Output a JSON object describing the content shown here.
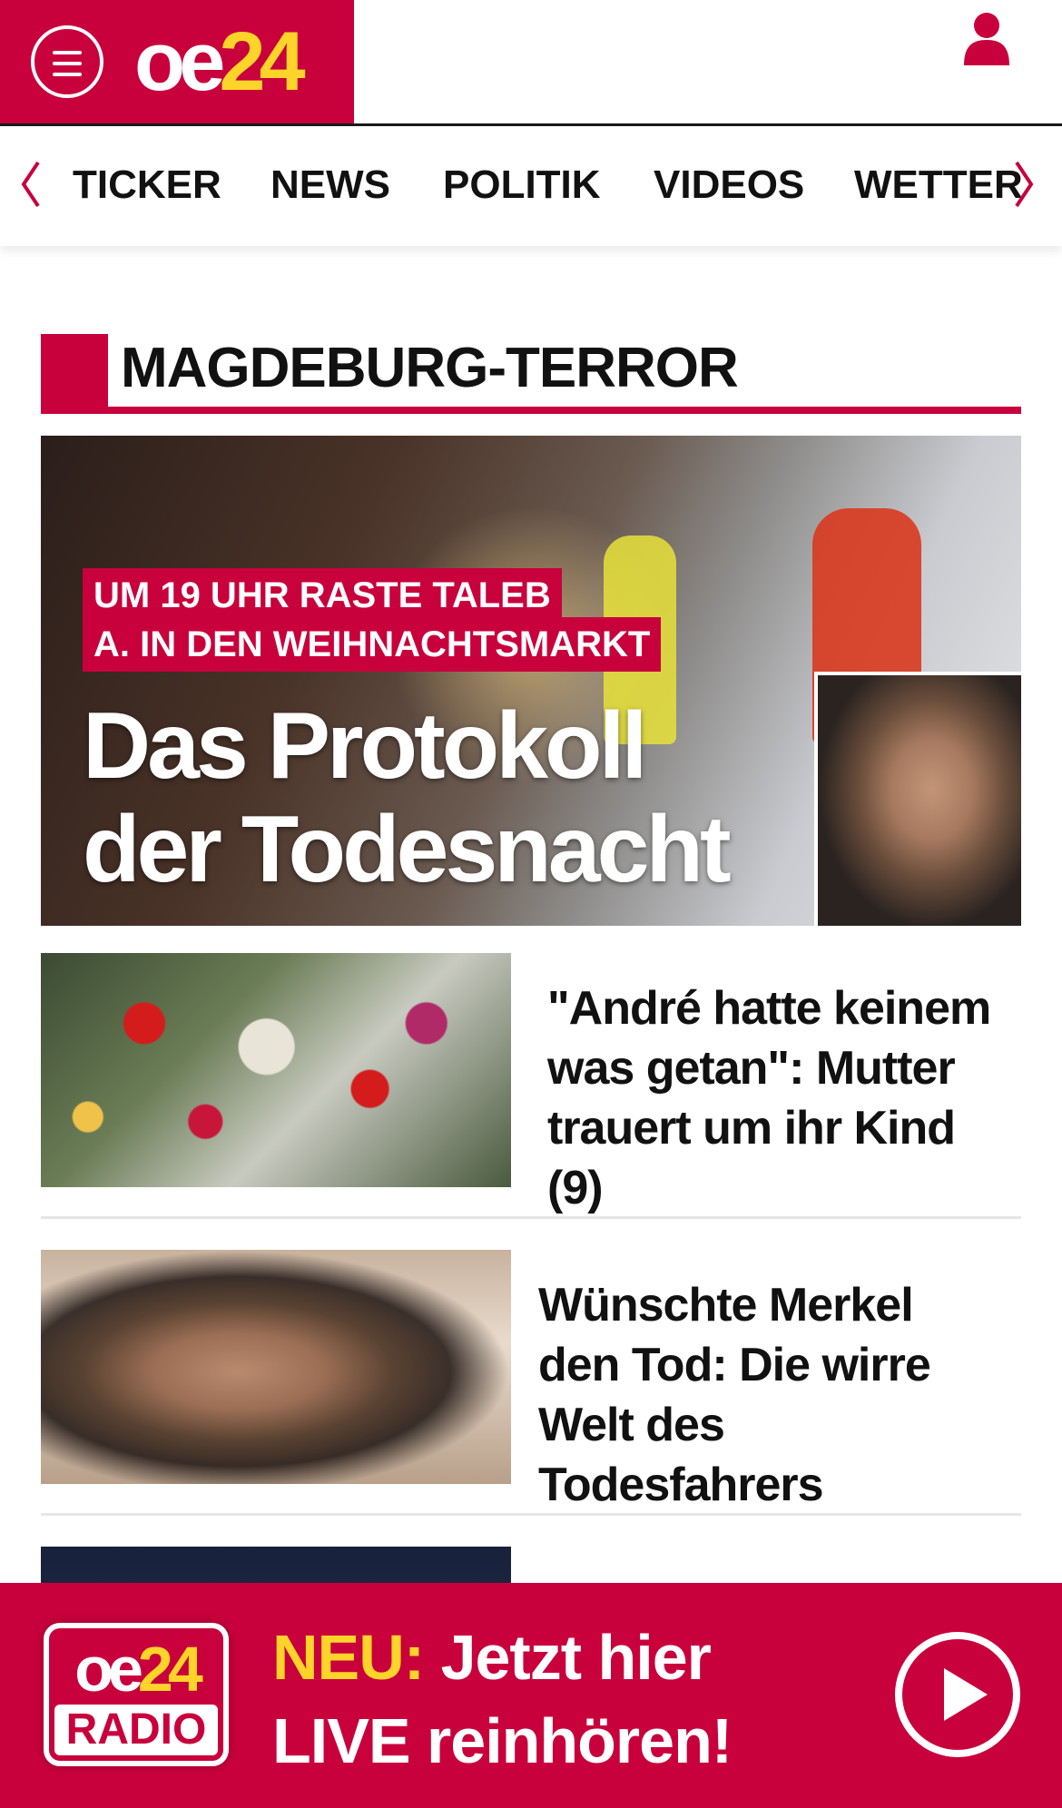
{
  "header": {
    "logo_oe": "oe",
    "logo_24": "24",
    "menu_icon": "hamburger-menu-icon",
    "user_icon": "user-icon"
  },
  "nav": {
    "items": [
      "TICKER",
      "NEWS",
      "POLITIK",
      "VIDEOS",
      "WETTER"
    ],
    "prev_icon": "chevron-left-icon",
    "next_icon": "chevron-right-icon"
  },
  "section": {
    "title": "MAGDEBURG-TERROR"
  },
  "hero": {
    "kicker_line1": "UM 19 UHR RASTE TALEB",
    "kicker_line2": "A. IN DEN WEIHNACHTSMARKT",
    "headline_line1": "Das Protokoll",
    "headline_line2": "der Todesnacht"
  },
  "articles": [
    {
      "title": "\"André hatte keinem was getan\": Mutter trauert um ihr Kind (9)"
    },
    {
      "title": "Wünschte Merkel den Tod: Die wirre Welt des Todesfahrers"
    },
    {
      "title": ""
    }
  ],
  "radio": {
    "logo_oe": "oe",
    "logo_24": "24",
    "logo_label": "RADIO",
    "neu": "NEU:",
    "line1": "Jetzt hier",
    "line2": "LIVE reinhören!",
    "play_icon": "play-icon"
  },
  "colors": {
    "brand_red": "#c8003c",
    "logo_yellow": "#ffd42a"
  }
}
